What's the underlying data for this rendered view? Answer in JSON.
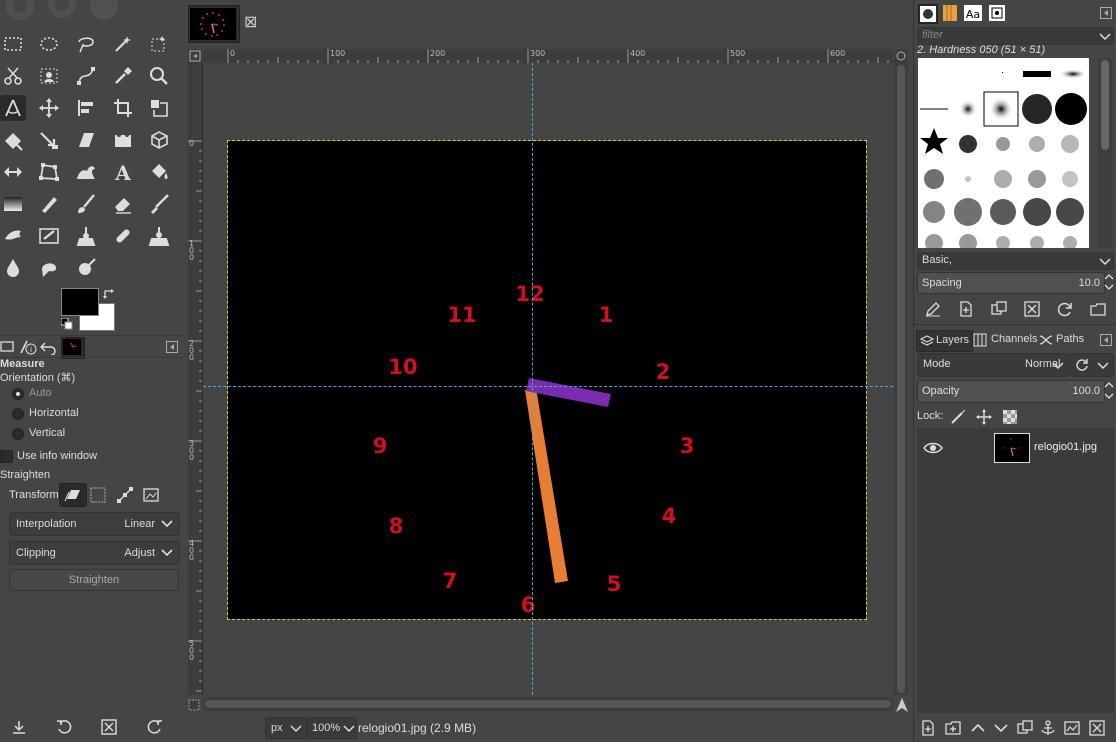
{
  "image_tab": {
    "close_label": "⊠"
  },
  "tool_options": {
    "title": "Measure",
    "orientation_label": "Orientation  (⌘)",
    "orientation_options": [
      "Auto",
      "Horizontal",
      "Vertical"
    ],
    "orientation_selected": "Auto",
    "use_info_window": "Use info window",
    "straighten_label": "Straighten",
    "transform_label": "Transform:",
    "interpolation_label": "Interpolation",
    "interpolation_value": "Linear",
    "clipping_label": "Clipping",
    "clipping_value": "Adjust",
    "straighten_button": "Straighten"
  },
  "rulers": {
    "top": [
      "0",
      "100",
      "200",
      "300",
      "400",
      "500",
      "600"
    ],
    "left": [
      "0",
      "1\n0\n0",
      "2\n0\n0",
      "3\n0\n0",
      "4\n0\n0",
      "5\n0\n0"
    ]
  },
  "clock": {
    "numbers": [
      "12",
      "1",
      "2",
      "3",
      "4",
      "5",
      "6",
      "7",
      "8",
      "9",
      "10",
      "11"
    ],
    "hour_hand_color": "#7a2bb0",
    "minute_hand_color": "#e87d35",
    "number_color": "#d0101c"
  },
  "status_bar": {
    "unit": "px",
    "zoom": "100%",
    "file_info": "relogio01.jpg (2.9 MB)"
  },
  "brushes": {
    "filter_placeholder": "filter",
    "selected_brush": "2. Hardness 050 (51 × 51)",
    "preset": "Basic,",
    "spacing_label": "Spacing",
    "spacing_value": "10.0"
  },
  "layers_panel": {
    "tabs": [
      "Layers",
      "Channels",
      "Paths"
    ],
    "mode_label": "Mode",
    "mode_value": "Normal",
    "opacity_label": "Opacity",
    "opacity_value": "100.0",
    "lock_label": "Lock:",
    "layer_name": "relogio01.jpg"
  }
}
